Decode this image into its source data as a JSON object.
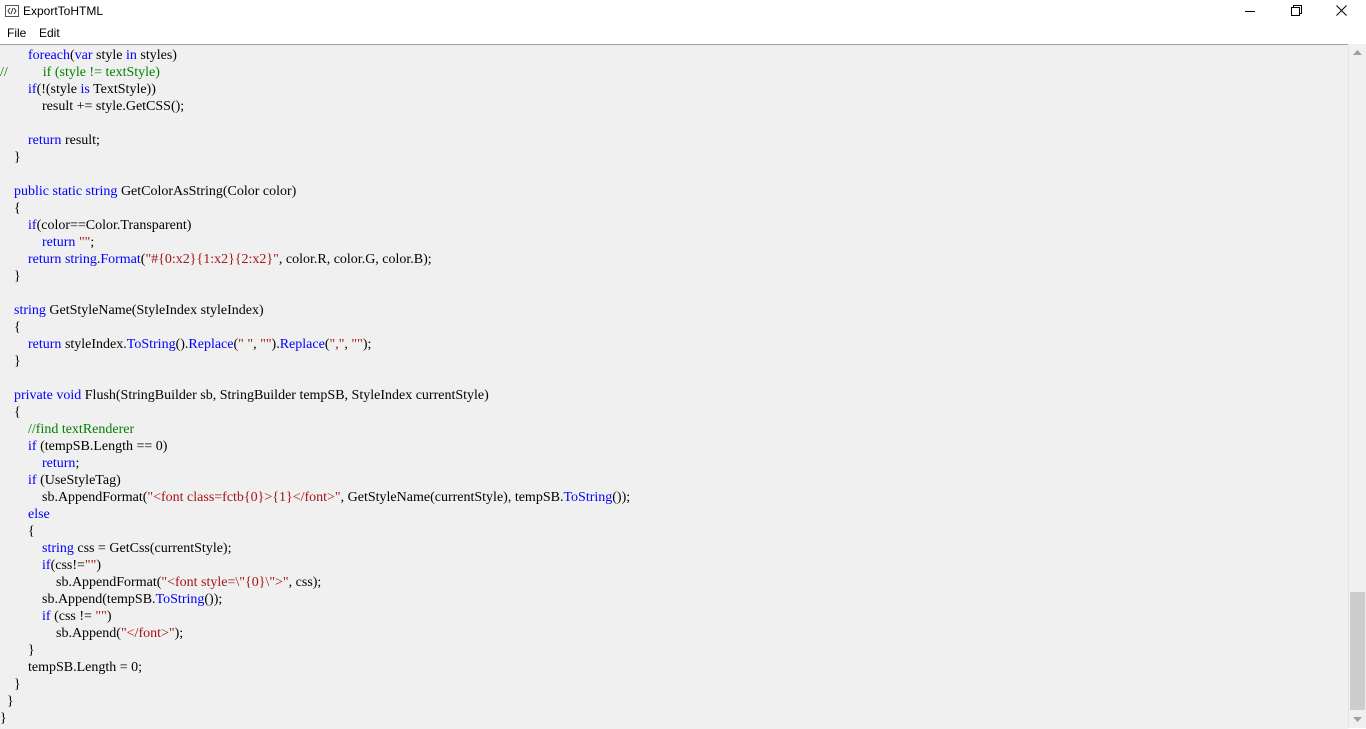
{
  "window": {
    "title": "ExportToHTML",
    "minimize": "—",
    "maximize": "❐",
    "close": "✕"
  },
  "menu": [
    {
      "label": "File"
    },
    {
      "label": "Edit"
    }
  ],
  "code_lines": [
    [
      [
        "        ",
        ""
      ],
      [
        "foreach",
        "kw"
      ],
      [
        "(",
        ""
      ],
      [
        "var",
        "kw"
      ],
      [
        " style ",
        ""
      ],
      [
        "in",
        "kw"
      ],
      [
        " styles)",
        ""
      ]
    ],
    [
      [
        "//          if (style != textStyle)",
        "cm"
      ]
    ],
    [
      [
        "        ",
        ""
      ],
      [
        "if",
        "kw"
      ],
      [
        "(!(style ",
        ""
      ],
      [
        "is",
        "kw"
      ],
      [
        " TextStyle))",
        ""
      ]
    ],
    [
      [
        "            result += style.GetCSS();",
        ""
      ]
    ],
    [],
    [
      [
        "        ",
        ""
      ],
      [
        "return",
        "kw"
      ],
      [
        " result;",
        ""
      ]
    ],
    [
      [
        "    }",
        ""
      ]
    ],
    [],
    [
      [
        "    ",
        ""
      ],
      [
        "public",
        "kw"
      ],
      [
        " ",
        ""
      ],
      [
        "static",
        "kw"
      ],
      [
        " ",
        ""
      ],
      [
        "string",
        "kw"
      ],
      [
        " GetColorAsString(Color color)",
        ""
      ]
    ],
    [
      [
        "    {",
        ""
      ]
    ],
    [
      [
        "        ",
        ""
      ],
      [
        "if",
        "kw"
      ],
      [
        "(color==Color.Transparent)",
        ""
      ]
    ],
    [
      [
        "            ",
        ""
      ],
      [
        "return",
        "kw"
      ],
      [
        " ",
        ""
      ],
      [
        "\"\"",
        "str"
      ],
      [
        ";",
        ""
      ]
    ],
    [
      [
        "        ",
        ""
      ],
      [
        "return",
        "kw"
      ],
      [
        " ",
        ""
      ],
      [
        "string",
        "kw"
      ],
      [
        ".",
        ""
      ],
      [
        "Format",
        "kw"
      ],
      [
        "(",
        ""
      ],
      [
        "\"#{0:x2}{1:x2}{2:x2}\"",
        "str"
      ],
      [
        ", color.R, color.G, color.B);",
        ""
      ]
    ],
    [
      [
        "    }",
        ""
      ]
    ],
    [],
    [
      [
        "    ",
        ""
      ],
      [
        "string",
        "kw"
      ],
      [
        " GetStyleName(StyleIndex styleIndex)",
        ""
      ]
    ],
    [
      [
        "    {",
        ""
      ]
    ],
    [
      [
        "        ",
        ""
      ],
      [
        "return",
        "kw"
      ],
      [
        " styleIndex.",
        ""
      ],
      [
        "ToString",
        "kw"
      ],
      [
        "().",
        ""
      ],
      [
        "Replace",
        "kw"
      ],
      [
        "(",
        ""
      ],
      [
        "\" \"",
        "str"
      ],
      [
        ", ",
        ""
      ],
      [
        "\"\"",
        "str"
      ],
      [
        ").",
        ""
      ],
      [
        "Replace",
        "kw"
      ],
      [
        "(",
        ""
      ],
      [
        "\",\"",
        "str"
      ],
      [
        ", ",
        ""
      ],
      [
        "\"\"",
        "str"
      ],
      [
        ");",
        ""
      ]
    ],
    [
      [
        "    }",
        ""
      ]
    ],
    [],
    [
      [
        "    ",
        ""
      ],
      [
        "private",
        "kw"
      ],
      [
        " ",
        ""
      ],
      [
        "void",
        "kw"
      ],
      [
        " Flush(StringBuilder sb, StringBuilder tempSB, StyleIndex currentStyle)",
        ""
      ]
    ],
    [
      [
        "    {",
        ""
      ]
    ],
    [
      [
        "        ",
        ""
      ],
      [
        "//find textRenderer",
        "cm"
      ]
    ],
    [
      [
        "        ",
        ""
      ],
      [
        "if",
        "kw"
      ],
      [
        " (tempSB.Length == 0)",
        ""
      ]
    ],
    [
      [
        "            ",
        ""
      ],
      [
        "return",
        "kw"
      ],
      [
        ";",
        ""
      ]
    ],
    [
      [
        "        ",
        ""
      ],
      [
        "if",
        "kw"
      ],
      [
        " (UseStyleTag)",
        ""
      ]
    ],
    [
      [
        "            sb.AppendFormat(",
        ""
      ],
      [
        "\"<font class=fctb{0}>{1}</font>\"",
        "str"
      ],
      [
        ", GetStyleName(currentStyle), tempSB.",
        ""
      ],
      [
        "ToString",
        "kw"
      ],
      [
        "());",
        ""
      ]
    ],
    [
      [
        "        ",
        ""
      ],
      [
        "else",
        "kw"
      ]
    ],
    [
      [
        "        {",
        ""
      ]
    ],
    [
      [
        "            ",
        ""
      ],
      [
        "string",
        "kw"
      ],
      [
        " css = GetCss(currentStyle);",
        ""
      ]
    ],
    [
      [
        "            ",
        ""
      ],
      [
        "if",
        "kw"
      ],
      [
        "(css!=",
        ""
      ],
      [
        "\"\"",
        "str"
      ],
      [
        ")",
        ""
      ]
    ],
    [
      [
        "                sb.AppendFormat(",
        ""
      ],
      [
        "\"<font style=\\\"{0}\\\">\"",
        "str"
      ],
      [
        ", css);",
        ""
      ]
    ],
    [
      [
        "            sb.Append(tempSB.",
        ""
      ],
      [
        "ToString",
        "kw"
      ],
      [
        "());",
        ""
      ]
    ],
    [
      [
        "            ",
        ""
      ],
      [
        "if",
        "kw"
      ],
      [
        " (css != ",
        ""
      ],
      [
        "\"\"",
        "str"
      ],
      [
        ")",
        ""
      ]
    ],
    [
      [
        "                sb.Append(",
        ""
      ],
      [
        "\"</font>\"",
        "str"
      ],
      [
        ");",
        ""
      ]
    ],
    [
      [
        "        }",
        ""
      ]
    ],
    [
      [
        "        tempSB.Length = 0;",
        ""
      ]
    ],
    [
      [
        "    }",
        ""
      ]
    ],
    [
      [
        "  }",
        ""
      ]
    ],
    [
      [
        "}",
        ""
      ]
    ]
  ]
}
